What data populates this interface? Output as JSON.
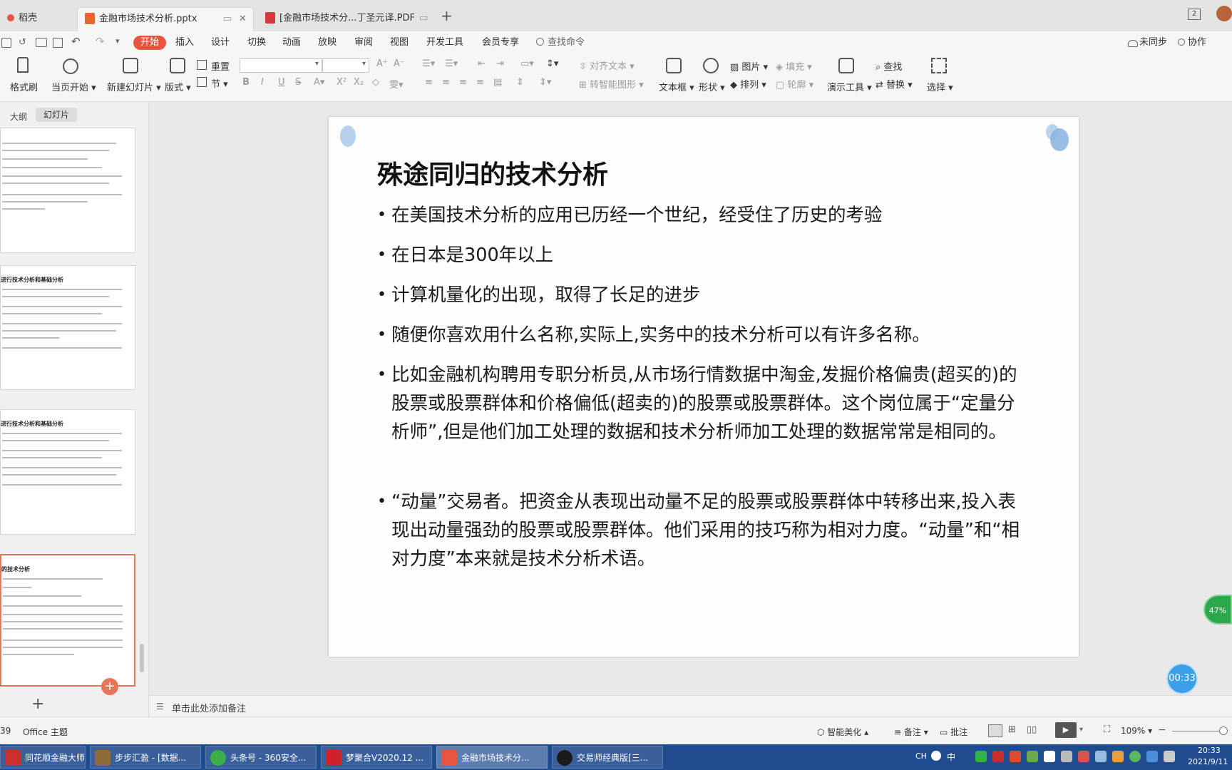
{
  "tabs": [
    {
      "label": "稻壳"
    },
    {
      "label": "金融市场技术分析.pptx"
    },
    {
      "label": "[金融市场技术分...丁圣元译.PDF"
    }
  ],
  "tab_new": "+",
  "window_badge": "2",
  "menu": {
    "items": [
      "开始",
      "插入",
      "设计",
      "切换",
      "动画",
      "放映",
      "审阅",
      "视图",
      "开发工具",
      "会员专享"
    ],
    "search": "查找命令",
    "right": {
      "sync": "未同步",
      "collab": "协作"
    }
  },
  "ribbon": {
    "format_painter": "格式刷",
    "play_current": "当页开始",
    "new_slide": "新建幻灯片",
    "layout": "版式",
    "reset": "重置",
    "section": "节",
    "align_text": "对齐文本",
    "smartart": "转智能图形",
    "textbox": "文本框",
    "shape": "形状",
    "picture": "图片",
    "fill": "填充",
    "arrange": "排列",
    "outline": "轮廓",
    "presenter": "演示工具",
    "find": "查找",
    "replace": "替换",
    "select": "选择"
  },
  "left_panel": {
    "tab_outline": "大纲",
    "tab_slides": "幻灯片",
    "thumbs": [
      {
        "title": ""
      },
      {
        "title": "进行技术分析和基础分析"
      },
      {
        "title": "进行技术分析和基础分析"
      },
      {
        "title": "的技术分析"
      }
    ],
    "add": "+"
  },
  "slide": {
    "title": "殊途同归的技术分析",
    "bullets": [
      "在美国技术分析的应用已历经一个世纪，经受住了历史的考验",
      "在日本是300年以上",
      "计算机量化的出现，取得了长足的进步",
      "随便你喜欢用什么名称,实际上,实务中的技术分析可以有许多名称。",
      "比如金融机构聘用专职分析员,从市场行情数据中淘金,发掘价格偏贵(超买的)的股票或股票群体和价格偏低(超卖的)的股票或股票群体。这个岗位属于“定量分析师”,但是他们加工处理的数据和技术分析师加工处理的数据常常是相同的。",
      "“动量”交易者。把资金从表现出动量不足的股票或股票群体中转移出来,投入表现出动量强劲的股票或股票群体。他们采用的技巧称为相对力度。“动量”和“相对力度”本来就是技术分析术语。"
    ]
  },
  "notes_placeholder": "单击此处添加备注",
  "floating": {
    "percent": "47%",
    "timer": "00:33"
  },
  "status": {
    "slide_num": "39",
    "theme": "Office 主题",
    "beautify": "智能美化",
    "notes": "备注",
    "comments": "批注",
    "zoom": "109%"
  },
  "taskbar": {
    "items": [
      {
        "label": "同花顺金融大师 -..."
      },
      {
        "label": "步步汇盈 - [数据..."
      },
      {
        "label": "头条号 - 360安全..."
      },
      {
        "label": "梦聚合V2020.12 ..."
      },
      {
        "label": "金融市场技术分..."
      },
      {
        "label": "交易师经典版[三..."
      }
    ],
    "lang": "CH",
    "ime": "中",
    "time": "20:33",
    "date": "2021/9/11"
  },
  "colors": {
    "accent": "#e8543e",
    "taskbar": "#1f4b8f",
    "selected_thumb": "#e8755a"
  }
}
